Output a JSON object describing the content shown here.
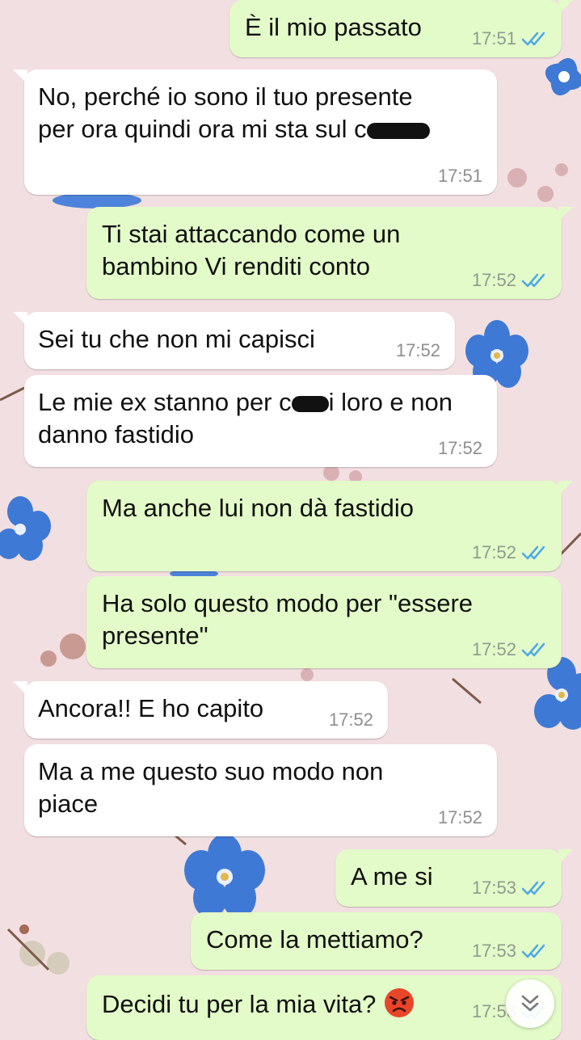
{
  "colors": {
    "incoming_bubble": "#ffffff",
    "outgoing_bubble": "#e3fbc8",
    "read_ticks": "#4fa8e6",
    "wallpaper": "#f2dfe1"
  },
  "messages": [
    {
      "direction": "outgoing",
      "text": "È il mio passato",
      "time": "17:51",
      "status": "read"
    },
    {
      "direction": "incoming",
      "line1": "No, perché io sono il tuo presente",
      "line2_start": "per ora quindi ora mi sta sul c",
      "time": "17:51",
      "redacted": true
    },
    {
      "direction": "outgoing",
      "text": "Ti stai attaccando come un bambino Vi renditi conto",
      "time": "17:52",
      "status": "read"
    },
    {
      "direction": "incoming",
      "text": "Sei tu che non mi capisci",
      "time": "17:52"
    },
    {
      "direction": "incoming",
      "text_start": "Le mie ex stanno per c",
      "text_end": "i loro e non danno fastidio",
      "time": "17:52",
      "redacted": true
    },
    {
      "direction": "outgoing",
      "text": "Ma anche lui non dà fastidio",
      "time": "17:52",
      "status": "read"
    },
    {
      "direction": "outgoing",
      "text": "Ha solo questo modo per \"essere presente\"",
      "time": "17:52",
      "status": "read"
    },
    {
      "direction": "incoming",
      "text": "Ancora!! E ho capito",
      "time": "17:52"
    },
    {
      "direction": "incoming",
      "text": "Ma a me questo suo modo non piace",
      "time": "17:52"
    },
    {
      "direction": "outgoing",
      "text": "A me si",
      "time": "17:53",
      "status": "read"
    },
    {
      "direction": "outgoing",
      "text": "Come la mettiamo?",
      "time": "17:53",
      "status": "read"
    },
    {
      "direction": "outgoing",
      "text": "Decidi tu per la mia vita?",
      "emoji": "angry-face-emoji",
      "time": "17:53",
      "status": "read"
    }
  ],
  "scroll_button_icon": "double-chevron-down-icon"
}
